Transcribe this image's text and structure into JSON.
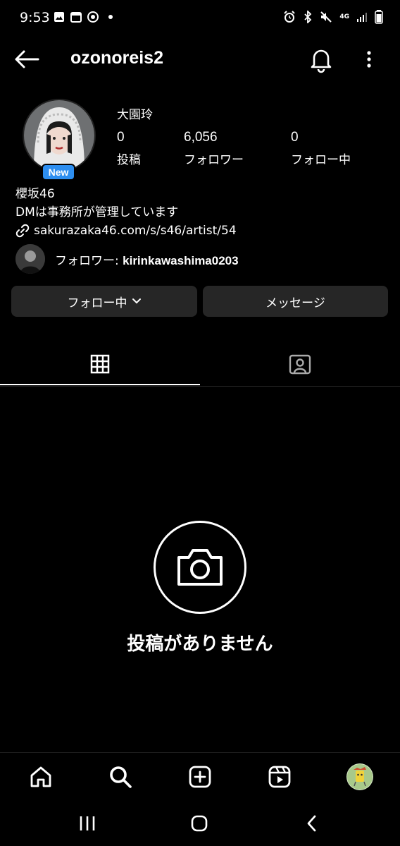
{
  "status_bar": {
    "time": "9:53",
    "network": "4G"
  },
  "header": {
    "username": "ozonoreis2"
  },
  "profile": {
    "display_name": "大園玲",
    "badge": "New",
    "stats": [
      {
        "value": "0",
        "label": "投稿"
      },
      {
        "value": "6,056",
        "label": "フォロワー"
      },
      {
        "value": "0",
        "label": "フォロー中"
      }
    ],
    "bio_lines": [
      "櫻坂46",
      "DMは事務所が管理しています"
    ],
    "link": "sakurazaka46.com/s/s46/artist/54",
    "followed_by_label": "フォロワー: ",
    "followed_by_user": "kirinkawashima0203"
  },
  "actions": {
    "following_label": "フォロー中",
    "message_label": "メッセージ"
  },
  "tabs": [
    {
      "icon": "grid-icon"
    },
    {
      "icon": "tagged-icon"
    }
  ],
  "empty_state": {
    "text": "投稿がありません"
  },
  "bottom_nav": [
    "home-icon",
    "search-icon",
    "create-icon",
    "reels-icon",
    "profile-avatar"
  ],
  "colors": {
    "badge": "#2d8ef0",
    "button_bg": "#262626",
    "background": "#000000"
  }
}
